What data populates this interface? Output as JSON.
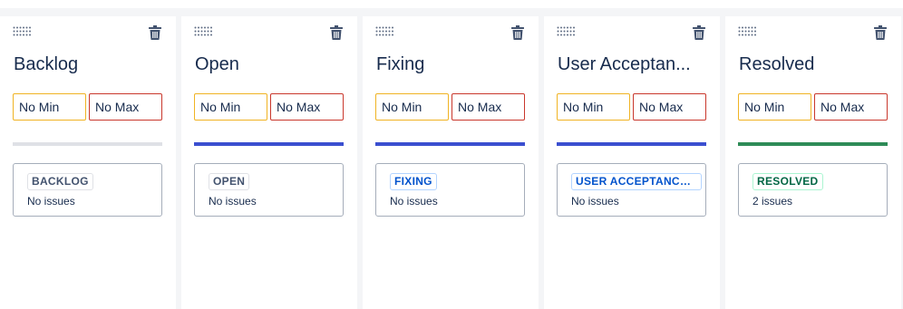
{
  "colors": {
    "min_border": "#f0b323",
    "max_border": "#c9372c",
    "bar_gray": "#dfe1e6",
    "bar_blue": "#3b4fd0",
    "bar_green": "#2e8b57"
  },
  "columns": [
    {
      "title": "Backlog",
      "min_placeholder": "No Min",
      "max_placeholder": "No Max",
      "status": "BACKLOG",
      "status_category": "gray",
      "bar_color": "#dfe1e6",
      "issue_count_text": "No issues",
      "icons": [
        "drag-handle-icon",
        "trash-icon"
      ]
    },
    {
      "title": "Open",
      "min_placeholder": "No Min",
      "max_placeholder": "No Max",
      "status": "OPEN",
      "status_category": "gray",
      "bar_color": "#3b4fd0",
      "issue_count_text": "No issues",
      "icons": [
        "drag-handle-icon",
        "trash-icon"
      ]
    },
    {
      "title": "Fixing",
      "min_placeholder": "No Min",
      "max_placeholder": "No Max",
      "status": "FIXING",
      "status_category": "blue",
      "bar_color": "#3b4fd0",
      "issue_count_text": "No issues",
      "icons": [
        "drag-handle-icon",
        "trash-icon"
      ]
    },
    {
      "title": "User Acceptan...",
      "min_placeholder": "No Min",
      "max_placeholder": "No Max",
      "status": "USER ACCEPTANCE ...",
      "status_category": "blue",
      "bar_color": "#3b4fd0",
      "issue_count_text": "No issues",
      "icons": [
        "drag-handle-icon",
        "trash-icon"
      ]
    },
    {
      "title": "Resolved",
      "min_placeholder": "No Min",
      "max_placeholder": "No Max",
      "status": "RESOLVED",
      "status_category": "green",
      "bar_color": "#2e8b57",
      "issue_count_text": "2 issues",
      "icons": [
        "drag-handle-icon",
        "trash-icon"
      ]
    }
  ]
}
